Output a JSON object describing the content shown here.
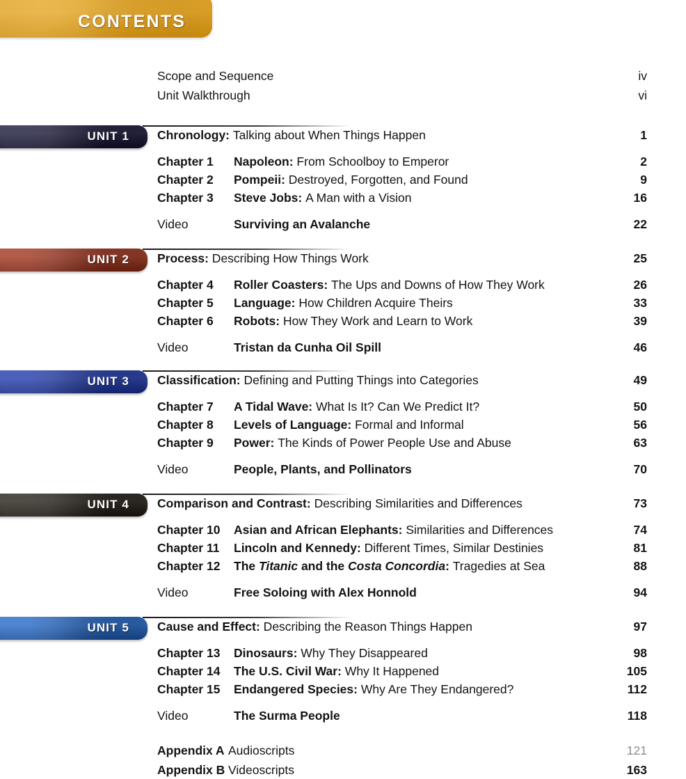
{
  "header": {
    "title": "CONTENTS",
    "color": "#e5a014"
  },
  "front_matter": [
    {
      "title": "Scope and Sequence",
      "page": "iv"
    },
    {
      "title": "Unit Walkthrough",
      "page": "vi"
    }
  ],
  "units": [
    {
      "banner_label": "UNIT 1",
      "color": "#141233",
      "heading": {
        "lead": "Chronology:",
        "sub": "Talking about When Things Happen",
        "page": "1"
      },
      "entries": [
        {
          "label": "Chapter 1",
          "lead": "Napoleon:",
          "sub": "From Schoolboy to Emperor",
          "page": "2"
        },
        {
          "label": "Chapter 2",
          "lead": "Pompeii:",
          "sub": "Destroyed, Forgotten, and Found",
          "page": "9"
        },
        {
          "label": "Chapter 3",
          "lead": "Steve Jobs:",
          "sub": "A Man with a Vision",
          "page": "16"
        },
        {
          "label": "Video",
          "lead": "Surviving an Avalanche",
          "sub": "",
          "page": "22"
        }
      ]
    },
    {
      "banner_label": "UNIT 2",
      "color": "#9c2f17",
      "heading": {
        "lead": "Process:",
        "sub": "Describing How Things Work",
        "page": "25"
      },
      "entries": [
        {
          "label": "Chapter 4",
          "lead": "Roller Coasters:",
          "sub": "The Ups and Downs of How They Work",
          "page": "26"
        },
        {
          "label": "Chapter 5",
          "lead": "Language:",
          "sub": "How Children Acquire Theirs",
          "page": "33"
        },
        {
          "label": "Chapter 6",
          "lead": "Robots:",
          "sub": "How They Work and Learn to Work",
          "page": "39"
        },
        {
          "label": "Video",
          "lead": "Tristan da Cunha Oil Spill",
          "sub": "",
          "page": "46"
        }
      ]
    },
    {
      "banner_label": "UNIT 3",
      "color": "#1b36a8",
      "heading": {
        "lead": "Classification:",
        "sub": "Defining and Putting Things into Categories",
        "page": "49"
      },
      "entries": [
        {
          "label": "Chapter 7",
          "lead": "A Tidal Wave:",
          "sub": "What Is It? Can We Predict It?",
          "page": "50"
        },
        {
          "label": "Chapter 8",
          "lead": "Levels of Language:",
          "sub": "Formal and Informal",
          "page": "56"
        },
        {
          "label": "Chapter 9",
          "lead": "Power:",
          "sub": "The Kinds of Power People Use and Abuse",
          "page": "63"
        },
        {
          "label": "Video",
          "lead": "People, Plants, and Pollinators",
          "sub": "",
          "page": "70"
        }
      ]
    },
    {
      "banner_label": "UNIT 4",
      "color": "#201a12",
      "heading": {
        "lead": "Comparison and Contrast:",
        "sub": "Describing Similarities and Differences",
        "page": "73"
      },
      "entries": [
        {
          "label": "Chapter 10",
          "lead": "Asian and African Elephants:",
          "sub": "Similarities and Differences",
          "page": "74"
        },
        {
          "label": "Chapter 11",
          "lead": "Lincoln and Kennedy:",
          "sub": "Different Times, Similar Destinies",
          "page": "81"
        },
        {
          "label": "Chapter 12",
          "lead_rich": [
            {
              "text": "The ",
              "style": "bold"
            },
            {
              "text": "Titanic",
              "style": "bold-italic"
            },
            {
              "text": " and the ",
              "style": "bold"
            },
            {
              "text": "Costa Concordia",
              "style": "bold-italic"
            },
            {
              "text": ":",
              "style": "bold"
            }
          ],
          "sub": "Tragedies at Sea",
          "page": "88"
        },
        {
          "label": "Video",
          "lead": "Free Soloing with Alex Honnold",
          "sub": "",
          "page": "94"
        }
      ]
    },
    {
      "banner_label": "UNIT 5",
      "color": "#1e63c4",
      "heading": {
        "lead": "Cause and Effect:",
        "sub": "Describing the Reason Things Happen",
        "page": "97"
      },
      "entries": [
        {
          "label": "Chapter 13",
          "lead": "Dinosaurs:",
          "sub": "Why They Disappeared",
          "page": "98"
        },
        {
          "label": "Chapter 14",
          "lead": "The U.S. Civil War:",
          "sub": "Why It Happened",
          "page": "105"
        },
        {
          "label": "Chapter 15",
          "lead": "Endangered Species:",
          "sub": "Why Are They Endangered?",
          "page": "112"
        },
        {
          "label": "Video",
          "lead": "The Surma People",
          "sub": "",
          "page": "118"
        }
      ]
    }
  ],
  "appendices": [
    {
      "label": "Appendix A",
      "title": "Audioscripts",
      "page": "121"
    },
    {
      "label": "Appendix B",
      "title": "Videoscripts",
      "page": "163"
    }
  ]
}
